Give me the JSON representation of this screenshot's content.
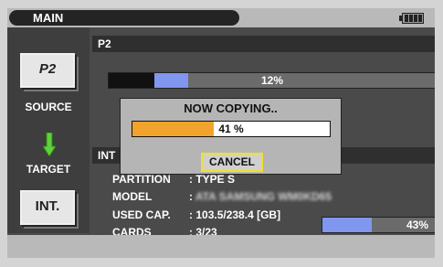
{
  "header": {
    "title": "MAIN",
    "battery_icon": "battery-icon"
  },
  "left": {
    "source_button": "P2",
    "source_label": "SOURCE",
    "arrow_icon": "down-arrow-icon",
    "target_label": "TARGET",
    "target_button": "INT."
  },
  "p2": {
    "header": "P2",
    "progress_text": "12%",
    "progress_value": 0.12
  },
  "int": {
    "header": "INT",
    "rows": [
      {
        "key": "PARTITION",
        "value": "TYPE S"
      },
      {
        "key": "MODEL",
        "value": "ATA SAMSUNG WM0KD65"
      },
      {
        "key": "USED CAP.",
        "value": "103.5/238.4 [GB]"
      },
      {
        "key": "CARDS",
        "value": "3/23"
      }
    ],
    "used_text": "43%",
    "used_value": 0.43
  },
  "dialog": {
    "title": "NOW COPYING..",
    "progress_text": "41 %",
    "progress_value": 0.41,
    "cancel_label": "CANCEL"
  },
  "colors": {
    "progress_fill": "#8096ef",
    "copy_fill": "#f2a32b",
    "focus_border": "#f2e12a"
  }
}
